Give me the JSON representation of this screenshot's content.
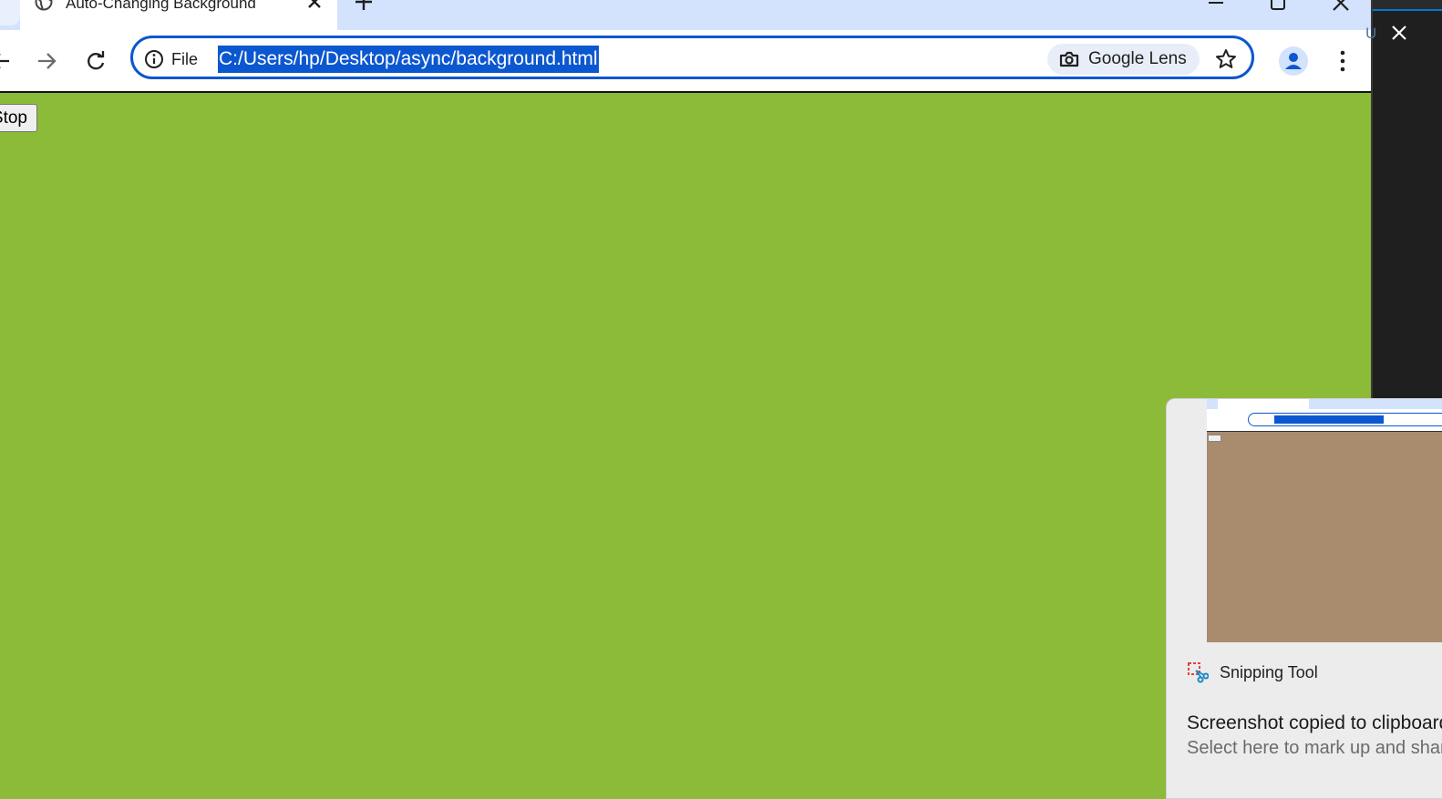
{
  "browser": {
    "tab": {
      "title": "Auto-Changing Background"
    },
    "address_bar": {
      "site_info_label": "File",
      "url": "C:/Users/hp/Desktop/async/background.html"
    },
    "lens_label": "Google Lens"
  },
  "page": {
    "background_color": "#8cbb3a",
    "stop_button_label": "Stop"
  },
  "notification": {
    "app_name": "Snipping Tool",
    "title": "Screenshot copied to clipboard",
    "body": "Select here to mark up and share",
    "thumbnail_background": "#a98b6e"
  },
  "right_app": {
    "partial_label": "U"
  },
  "icons": {
    "tab_favicon": "globe-icon",
    "tab_close": "close-icon",
    "new_tab": "plus-icon",
    "minimize": "minimize-icon",
    "maximize": "restore-icon",
    "window_close": "close-icon",
    "back": "back-arrow-icon",
    "forward": "forward-arrow-icon",
    "reload": "reload-icon",
    "site_info": "info-icon",
    "lens": "camera-search-icon",
    "bookmark": "star-icon",
    "profile": "person-icon",
    "menu": "kebab-menu-icon",
    "snipping_tool": "snipping-tool-icon"
  },
  "colors": {
    "accent": "#0b57d0",
    "tabstrip": "#d3e3fd"
  }
}
